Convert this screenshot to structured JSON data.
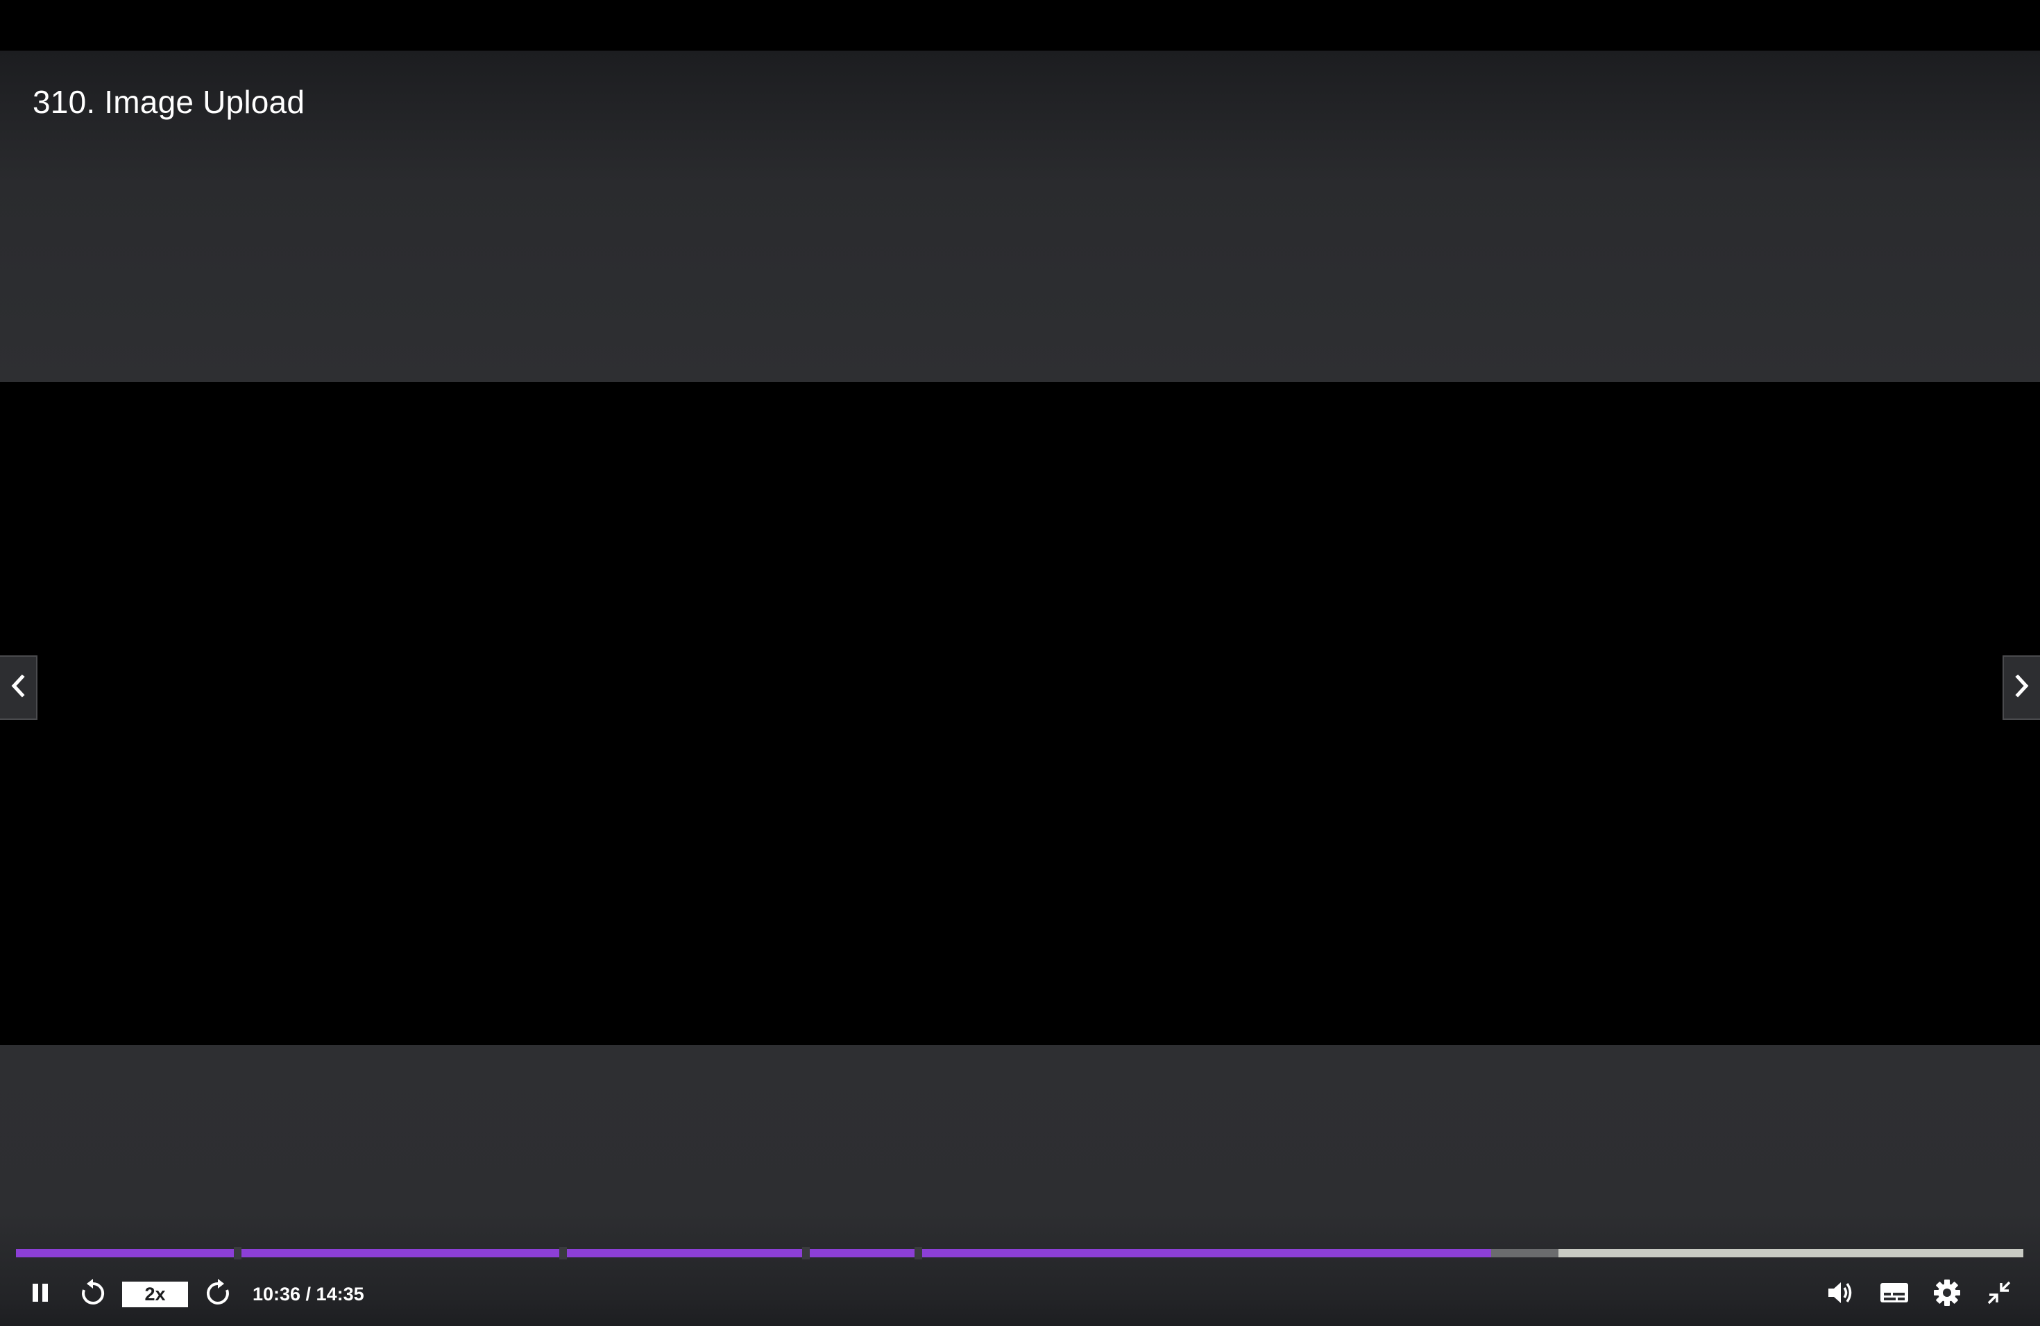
{
  "lecture": {
    "title": "310. Image Upload"
  },
  "playback": {
    "speed_label": "2x",
    "time_display": "10:36 / 14:35",
    "current_time": "10:36",
    "duration": "14:35",
    "played_fraction": 0.7349,
    "buffered_fraction": 0.7685
  },
  "chapters": {
    "marker_fractions": [
      0.1102,
      0.2724,
      0.3935,
      0.4493
    ]
  },
  "colors": {
    "progress_played": "#8c3fd6",
    "progress_buffered": "#6b6c6e",
    "progress_track": "#c9cbc4",
    "overlay_background": "#2e2f32",
    "text": "#ffffff"
  },
  "icons": {
    "pause": "pause-icon",
    "rewind": "rewind-5-icon",
    "forward": "forward-5-icon",
    "volume": "volume-icon",
    "captions": "captions-icon",
    "settings": "gear-icon",
    "exit_fullscreen": "exit-fullscreen-icon",
    "prev": "chevron-left-icon",
    "next": "chevron-right-icon"
  }
}
